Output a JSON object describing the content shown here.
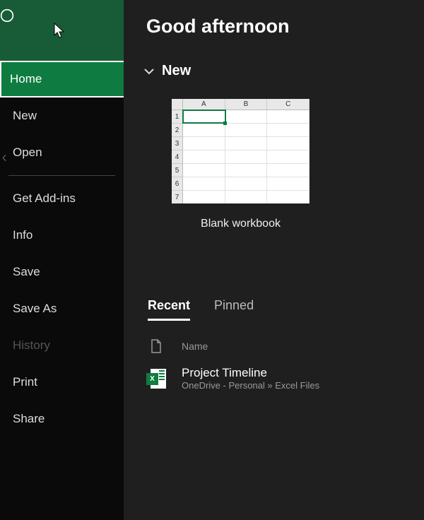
{
  "greeting": "Good afternoon",
  "sidebar": {
    "home": "Home",
    "new": "New",
    "open": "Open",
    "get_addins": "Get Add-ins",
    "info": "Info",
    "save": "Save",
    "save_as": "Save As",
    "history": "History",
    "print": "Print",
    "share": "Share"
  },
  "sections": {
    "new": "New"
  },
  "templates": {
    "blank": {
      "label": "Blank workbook",
      "cols": [
        "A",
        "B",
        "C"
      ],
      "rows": [
        "1",
        "2",
        "3",
        "4",
        "5",
        "6",
        "7"
      ]
    }
  },
  "tabs": {
    "recent": "Recent",
    "pinned": "Pinned"
  },
  "file_list": {
    "header_name": "Name",
    "items": [
      {
        "name": "Project Timeline",
        "path": "OneDrive - Personal » Excel Files",
        "badge": "X"
      }
    ]
  }
}
